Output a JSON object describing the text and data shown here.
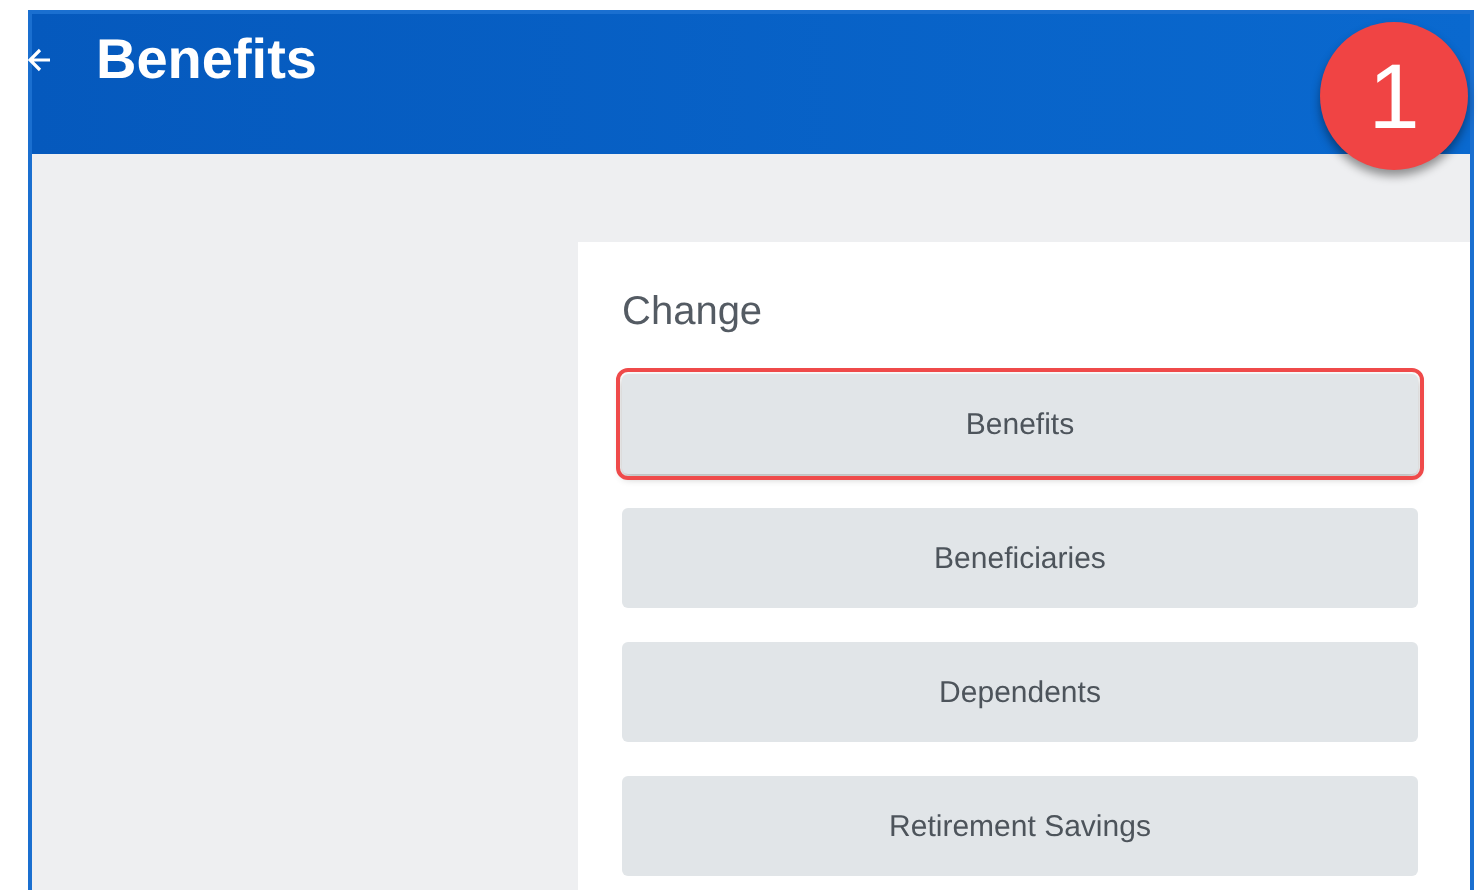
{
  "header": {
    "title": "Benefits"
  },
  "step_badge": "1",
  "card": {
    "title": "Change",
    "buttons": [
      {
        "label": "Benefits",
        "highlighted": true
      },
      {
        "label": "Beneficiaries",
        "highlighted": false
      },
      {
        "label": "Dependents",
        "highlighted": false
      },
      {
        "label": "Retirement Savings",
        "highlighted": false
      }
    ]
  }
}
